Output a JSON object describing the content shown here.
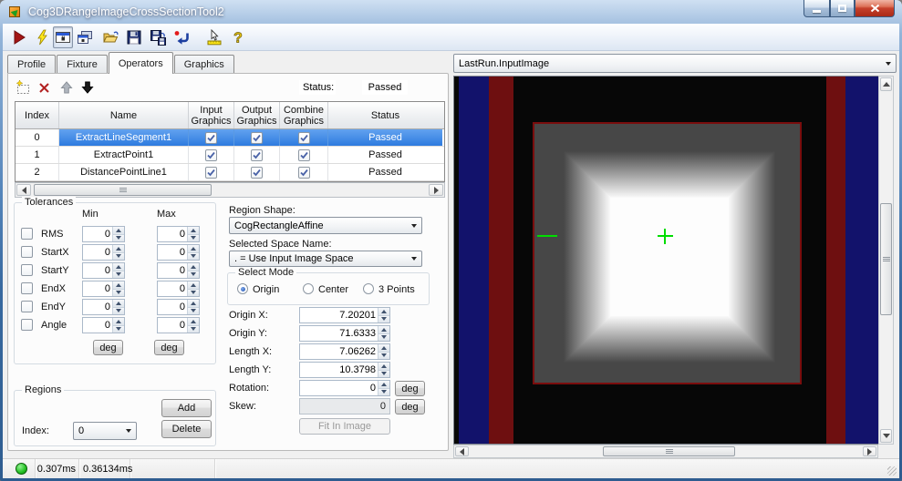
{
  "window": {
    "title": "Cog3DRangeImageCrossSectionTool2"
  },
  "toolbar": {
    "buttons": [
      "run",
      "electric-trigger",
      "show-current-params",
      "float-window",
      "open-file",
      "save-file",
      "save-as",
      "reset",
      "measure-tools",
      "help"
    ]
  },
  "tabs": {
    "active_index": 2,
    "items": [
      {
        "label": "Profile"
      },
      {
        "label": "Fixture"
      },
      {
        "label": "Operators"
      },
      {
        "label": "Graphics"
      }
    ]
  },
  "operators": {
    "status_label": "Status:",
    "status_value": "Passed",
    "columns": [
      "Index",
      "Name",
      "Input Graphics",
      "Output Graphics",
      "Combine Graphics",
      "Status"
    ],
    "rows": [
      {
        "index": "0",
        "name": "ExtractLineSegment1",
        "input_graphics": true,
        "output_graphics": true,
        "combine_graphics": true,
        "status": "Passed",
        "selected": true
      },
      {
        "index": "1",
        "name": "ExtractPoint1",
        "input_graphics": true,
        "output_graphics": true,
        "combine_graphics": true,
        "status": "Passed",
        "selected": false
      },
      {
        "index": "2",
        "name": "DistancePointLine1",
        "input_graphics": true,
        "output_graphics": true,
        "combine_graphics": true,
        "status": "Passed",
        "selected": false
      }
    ]
  },
  "tolerances": {
    "title": "Tolerances",
    "min_header": "Min",
    "max_header": "Max",
    "deg_label": "deg",
    "rows": [
      {
        "label": "RMS",
        "enabled": false,
        "min": "0",
        "max": "0"
      },
      {
        "label": "StartX",
        "enabled": false,
        "min": "0",
        "max": "0"
      },
      {
        "label": "StartY",
        "enabled": false,
        "min": "0",
        "max": "0"
      },
      {
        "label": "EndX",
        "enabled": false,
        "min": "0",
        "max": "0"
      },
      {
        "label": "EndY",
        "enabled": false,
        "min": "0",
        "max": "0"
      },
      {
        "label": "Angle",
        "enabled": false,
        "min": "0",
        "max": "0"
      }
    ]
  },
  "regions": {
    "title": "Regions",
    "add_label": "Add",
    "delete_label": "Delete",
    "index_label": "Index:",
    "index_value": "0"
  },
  "region_shape": {
    "label": "Region Shape:",
    "value": "CogRectangleAffine"
  },
  "space_name": {
    "label": "Selected Space Name:",
    "value": ". = Use Input Image Space"
  },
  "select_mode": {
    "title": "Select Mode",
    "options": [
      {
        "label": "Origin",
        "selected": true
      },
      {
        "label": "Center",
        "selected": false
      },
      {
        "label": "3 Points",
        "selected": false
      }
    ]
  },
  "region_fields": {
    "deg_label": "deg",
    "fit_button_label": "Fit In Image",
    "rows": [
      {
        "label": "Origin X:",
        "value": "7.20201",
        "deg": false,
        "disabled": false
      },
      {
        "label": "Origin Y:",
        "value": "71.6333",
        "deg": false,
        "disabled": false
      },
      {
        "label": "Length X:",
        "value": "7.06262",
        "deg": false,
        "disabled": false
      },
      {
        "label": "Length Y:",
        "value": "10.3798",
        "deg": false,
        "disabled": false
      },
      {
        "label": "Rotation:",
        "value": "0",
        "deg": true,
        "disabled": false
      },
      {
        "label": "Skew:",
        "value": "0",
        "deg": true,
        "disabled": true
      }
    ]
  },
  "display": {
    "source": "LastRun.InputImage"
  },
  "statusbar": {
    "time1": "0.307ms",
    "time2": "0.36134ms"
  },
  "colors": {
    "selection_blue": "#2e7bdf",
    "status_green": "#22c02e",
    "image_navy": "#12126b",
    "image_dark_red": "#6e0f10",
    "graphic_green": "#00dd00",
    "region_outline_red": "#7a0d0d"
  }
}
